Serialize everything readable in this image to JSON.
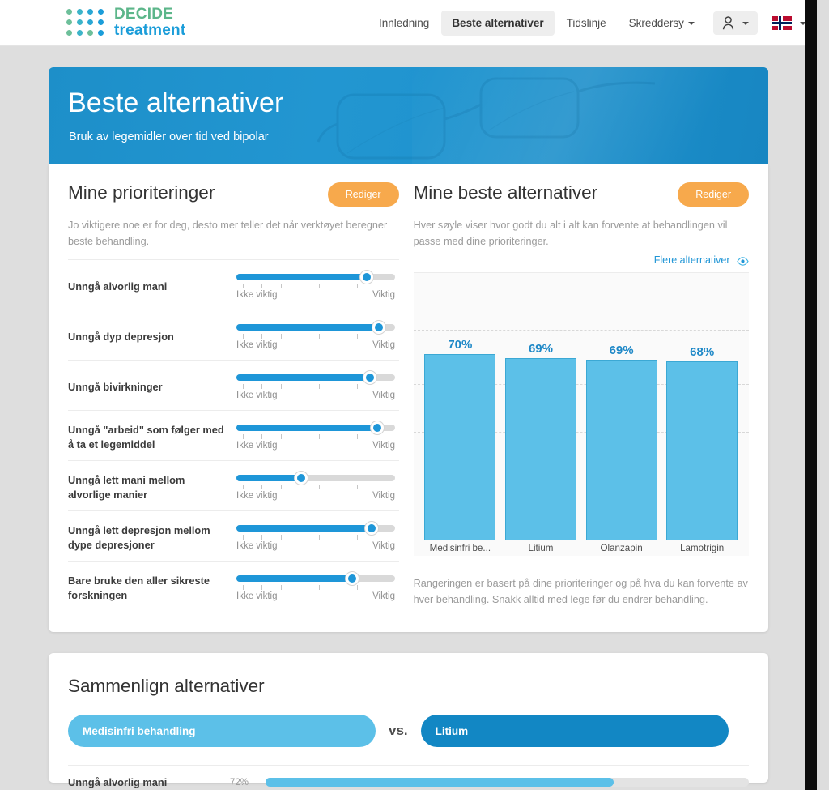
{
  "brand": {
    "line1": "DECIDE",
    "line2": "treatment",
    "color_green": "#5cb68a",
    "color_blue": "#1b9dd9"
  },
  "nav": {
    "items": [
      {
        "label": "Innledning",
        "active": false,
        "caret": false
      },
      {
        "label": "Beste alternativer",
        "active": true,
        "caret": false
      },
      {
        "label": "Tidslinje",
        "active": false,
        "caret": false
      },
      {
        "label": "Skreddersy",
        "active": false,
        "caret": true
      }
    ],
    "user_icon": "user-icon",
    "flag_icon": "norway-flag-icon"
  },
  "hero": {
    "title": "Beste alternativer",
    "subtitle": "Bruk av legemidler over tid ved bipolar",
    "bg_color": "#2296d1"
  },
  "priorities": {
    "title": "Mine prioriteringer",
    "edit_label": "Rediger",
    "description": "Jo viktigere noe er for deg, desto mer teller det når verktøyet beregner beste behandling.",
    "scale_min": "Ikke viktig",
    "scale_max": "Viktig",
    "items": [
      {
        "label": "Unngå alvorlig mani",
        "value": 82
      },
      {
        "label": "Unngå dyp depresjon",
        "value": 90
      },
      {
        "label": "Unngå bivirkninger",
        "value": 84
      },
      {
        "label": "Unngå \"arbeid\" som følger med å ta et legemiddel",
        "value": 89
      },
      {
        "label": "Unngå lett mani mellom alvorlige manier",
        "value": 41
      },
      {
        "label": "Unngå lett depresjon mellom dype depresjoner",
        "value": 85
      },
      {
        "label": "Bare bruke den aller sikreste forskningen",
        "value": 73
      }
    ]
  },
  "best_options": {
    "title": "Mine beste alternativer",
    "edit_label": "Rediger",
    "description": "Hver søyle viser hvor godt du alt i alt kan forvente at behandlingen vil passe med dine prioriteringer.",
    "more_link": "Flere alternativer",
    "more_icon": "eye-icon",
    "note": "Rangeringen er basert på dine prioriteringer og på hva du kan forvente av hver behandling. Snakk alltid med lege før du endrer behandling."
  },
  "chart_data": {
    "type": "bar",
    "title": "Mine beste alternativer",
    "categories": [
      "Medisinfri be...",
      "Litium",
      "Olanzapin",
      "Lamotrigin"
    ],
    "values": [
      70,
      69,
      69,
      68
    ],
    "value_labels": [
      "70%",
      "69%",
      "69%",
      "68%"
    ],
    "xlabel": "",
    "ylabel": "",
    "ylim": [
      0,
      100
    ],
    "grid": true,
    "gridlines": [
      25,
      45,
      65,
      85
    ],
    "legend": "none",
    "bar_color": "#5cc0e8",
    "bar_border_color": "#3ba8d4",
    "label_color": "#1e88c7"
  },
  "compare": {
    "title": "Sammenlign alternativer",
    "vs_label": "vs.",
    "option_a": "Medisinfri behandling",
    "option_b": "Litium",
    "rows": [
      {
        "label": "Unngå alvorlig mani",
        "percent_label": "72%",
        "percent": 72
      }
    ]
  }
}
